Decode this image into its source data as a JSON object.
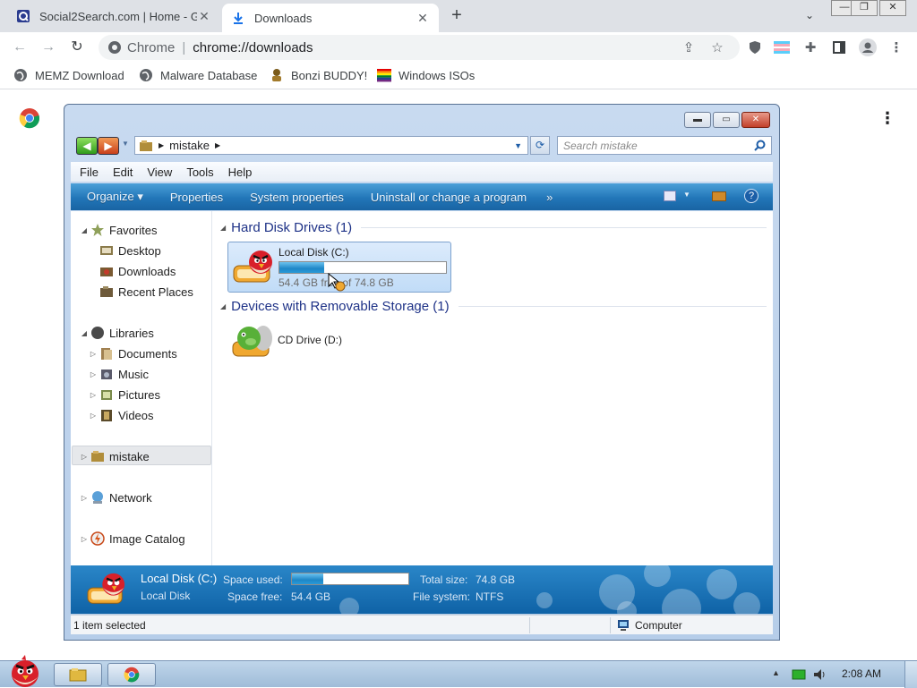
{
  "browser": {
    "tabs": [
      {
        "title": "Social2Search.com | Home - G",
        "active": false
      },
      {
        "title": "Downloads",
        "active": true
      }
    ],
    "new_tab_label": "+",
    "omnibox": {
      "chip": "Chrome",
      "url": "chrome://downloads"
    },
    "bookmarks": [
      {
        "label": "MEMZ Download",
        "icon": "globe-icon"
      },
      {
        "label": "Malware Database",
        "icon": "globe-icon"
      },
      {
        "label": "Bonzi BUDDY!",
        "icon": "bonzi-icon"
      },
      {
        "label": "Windows ISOs",
        "icon": "rainbow-flag-icon"
      }
    ]
  },
  "explorer": {
    "breadcrumb": "mistake",
    "search_placeholder": "Search mistake",
    "menu": [
      "File",
      "Edit",
      "View",
      "Tools",
      "Help"
    ],
    "commands": [
      "Organize ▾",
      "Properties",
      "System properties",
      "Uninstall or change a program",
      "»"
    ],
    "nav": {
      "favorites": "Favorites",
      "desktop": "Desktop",
      "downloads": "Downloads",
      "recent": "Recent Places",
      "libraries": "Libraries",
      "documents": "Documents",
      "music": "Music",
      "pictures": "Pictures",
      "videos": "Videos",
      "mistake": "mistake",
      "network": "Network",
      "image_catalog": "Image Catalog"
    },
    "groups": {
      "hdd": "Hard Disk Drives (1)",
      "removable": "Devices with Removable Storage (1)"
    },
    "drive_c": {
      "name": "Local Disk (C:)",
      "free_text": "54.4 GB free of 74.8 GB",
      "used_fraction": 0.27
    },
    "drive_d": {
      "name": "CD Drive (D:)"
    },
    "details": {
      "title": "Local Disk (C:)",
      "subtitle": "Local Disk",
      "space_used_label": "Space used:",
      "space_free_label": "Space free:",
      "space_free_value": "54.4 GB",
      "total_size_label": "Total size:",
      "total_size_value": "74.8 GB",
      "fs_label": "File system:",
      "fs_value": "NTFS",
      "used_fraction": 0.27
    },
    "status": {
      "selection": "1 item selected",
      "location": "Computer"
    }
  },
  "taskbar": {
    "clock": "2:08 AM"
  },
  "colors": {
    "accent": "#1a73e8",
    "cmdbar": "#2276b8",
    "explorer_frame": "#c8daf0"
  }
}
